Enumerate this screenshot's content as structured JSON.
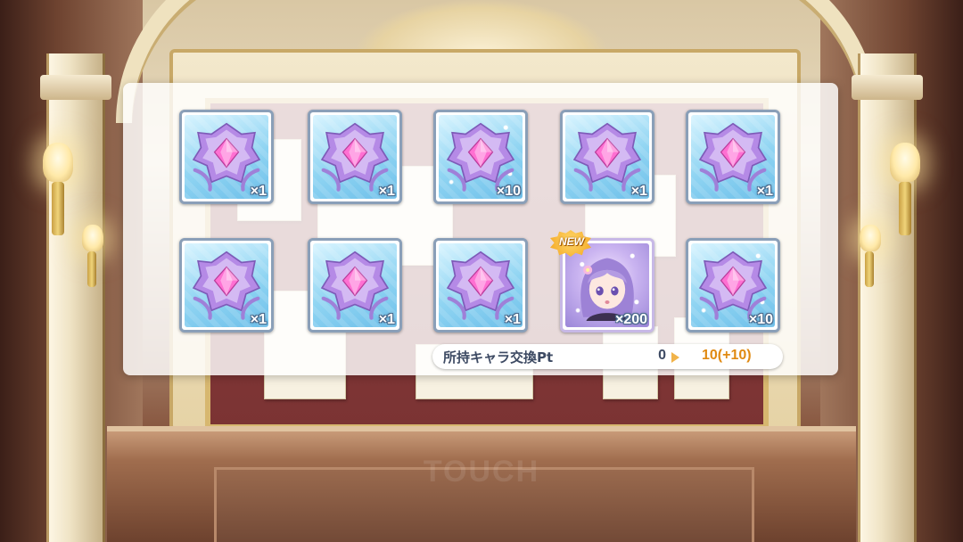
{
  "items": [
    {
      "type": "gem",
      "qty": "×1",
      "sparkle": false
    },
    {
      "type": "gem",
      "qty": "×1",
      "sparkle": false
    },
    {
      "type": "gem",
      "qty": "×10",
      "sparkle": true
    },
    {
      "type": "gem",
      "qty": "×1",
      "sparkle": false
    },
    {
      "type": "gem",
      "qty": "×1",
      "sparkle": false
    },
    {
      "type": "gem",
      "qty": "×1",
      "sparkle": false
    },
    {
      "type": "gem",
      "qty": "×1",
      "sparkle": false
    },
    {
      "type": "gem",
      "qty": "×1",
      "sparkle": false
    },
    {
      "type": "character",
      "qty": "×200",
      "badge": "NEW",
      "sparkle": true
    },
    {
      "type": "gem",
      "qty": "×10",
      "sparkle": true
    }
  ],
  "points": {
    "label": "所持キャラ交換Pt",
    "old_value": "0",
    "new_value": "10(+10)"
  },
  "touch_prompt": "TOUCH",
  "colors": {
    "panel_bg": "#ffffffd1",
    "item_bg": "#8fd4f2",
    "gem": "#b58ae6",
    "gem_core": "#ff6fd2",
    "points_accent": "#e08a12",
    "points_text": "#3d4a63"
  },
  "icons": {
    "gem": "memory-gem-icon",
    "character": "character-portrait-icon",
    "arrow": "arrow-right-icon"
  }
}
